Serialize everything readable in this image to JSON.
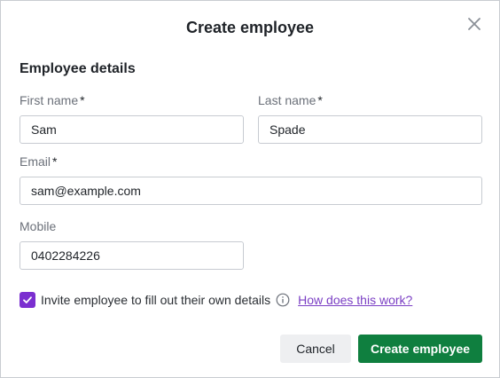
{
  "dialog": {
    "title": "Create employee",
    "section_title": "Employee details"
  },
  "fields": {
    "first_name": {
      "label": "First name",
      "required_marker": "*",
      "value": "Sam"
    },
    "last_name": {
      "label": "Last name",
      "required_marker": "*",
      "value": "Spade"
    },
    "email": {
      "label": "Email",
      "required_marker": "*",
      "value": "sam@example.com"
    },
    "mobile": {
      "label": "Mobile",
      "value": "0402284226"
    }
  },
  "invite": {
    "checked": true,
    "label": "Invite employee to fill out their own details",
    "help_link": "How does this work?"
  },
  "actions": {
    "cancel_label": "Cancel",
    "create_label": "Create employee"
  },
  "colors": {
    "accent_purple": "#7b2fd0",
    "primary_green": "#0f7f3f"
  },
  "icons": {
    "close": "close-icon",
    "check": "check-icon",
    "info": "info-icon"
  }
}
